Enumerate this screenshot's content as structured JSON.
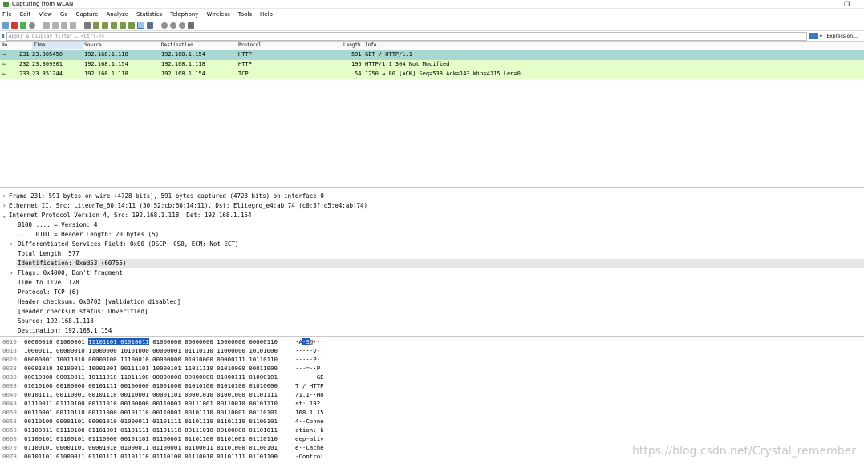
{
  "window": {
    "title": "Capturing from WLAN",
    "restore": "❐"
  },
  "menu": [
    "File",
    "Edit",
    "View",
    "Go",
    "Capture",
    "Analyze",
    "Statistics",
    "Telephony",
    "Wireless",
    "Tools",
    "Help"
  ],
  "toolbar_icons": [
    "shark-fin-icon",
    "stop-icon",
    "restart-icon",
    "options-gear-icon",
    "open-file-icon",
    "save-file-icon",
    "close-file-icon",
    "reload-icon",
    "find-icon",
    "back-icon",
    "forward-icon",
    "go-to-packet-icon",
    "first-packet-icon",
    "last-packet-icon",
    "autoscroll-icon",
    "colorize-icon",
    "zoom-in-icon",
    "zoom-out-icon",
    "normal-size-icon",
    "resize-columns-icon"
  ],
  "filter": {
    "placeholder": "Apply a display filter … <Ctrl-/>",
    "expression": "Expression…",
    "bookmark": "▮",
    "dropdown": "▾"
  },
  "columns": [
    "No.",
    "Time",
    "Source",
    "Destination",
    "Protocol",
    "Length",
    "Info"
  ],
  "packets": [
    {
      "arrow": "→",
      "no": "231",
      "time": "23.305450",
      "src": "192.168.1.118",
      "dst": "192.168.1.154",
      "proto": "HTTP",
      "len": "591",
      "info": "GET / HTTP/1.1",
      "selected": true
    },
    {
      "arrow": "←",
      "no": "232",
      "time": "23.309301",
      "src": "192.168.1.154",
      "dst": "192.168.1.118",
      "proto": "HTTP",
      "len": "196",
      "info": "HTTP/1.1 304 Not Modified",
      "selected": false
    },
    {
      "arrow": "←",
      "no": "233",
      "time": "23.351244",
      "src": "192.168.1.118",
      "dst": "192.168.1.154",
      "proto": "TCP",
      "len": "54",
      "info": "1250 → 80 [ACK] Seq=538 Ack=143 Win=4115 Len=0",
      "selected": false
    }
  ],
  "details": [
    {
      "twisty": "›",
      "indent": 0,
      "text": "Frame 231: 591 bytes on wire (4728 bits), 591 bytes captured (4728 bits) on interface 0",
      "hl": false
    },
    {
      "twisty": "›",
      "indent": 0,
      "text": "Ethernet II, Src: LiteonTe_60:14:11 (30:52:cb:60:14:11), Dst: Elitegro_e4:ab:74 (c0:3f:d5:e4:ab:74)",
      "hl": false
    },
    {
      "twisty": "⌄",
      "indent": 0,
      "text": "Internet Protocol Version 4, Src: 192.168.1.118, Dst: 192.168.1.154",
      "hl": false
    },
    {
      "twisty": "",
      "indent": 1,
      "text": "0100 .... = Version: 4",
      "hl": false
    },
    {
      "twisty": "",
      "indent": 1,
      "text": ".... 0101 = Header Length: 20 bytes (5)",
      "hl": false
    },
    {
      "twisty": "›",
      "indent": 1,
      "text": "Differentiated Services Field: 0x00 (DSCP: CS0, ECN: Not-ECT)",
      "hl": false
    },
    {
      "twisty": "",
      "indent": 1,
      "text": "Total Length: 577",
      "hl": false
    },
    {
      "twisty": "",
      "indent": 1,
      "text": "Identification: 0xed53 (60755)",
      "hl": true
    },
    {
      "twisty": "›",
      "indent": 1,
      "text": "Flags: 0x4000, Don't fragment",
      "hl": false
    },
    {
      "twisty": "",
      "indent": 1,
      "text": "Time to live: 128",
      "hl": false
    },
    {
      "twisty": "",
      "indent": 1,
      "text": "Protocol: TCP (6)",
      "hl": false
    },
    {
      "twisty": "",
      "indent": 1,
      "text": "Header checksum: 0x8702 [validation disabled]",
      "hl": false
    },
    {
      "twisty": "",
      "indent": 1,
      "text": "[Header checksum status: Unverified]",
      "hl": false
    },
    {
      "twisty": "",
      "indent": 1,
      "text": "Source: 192.168.1.118",
      "hl": false
    },
    {
      "twisty": "",
      "indent": 1,
      "text": "Destination: 192.168.1.154",
      "hl": false
    }
  ],
  "bytes": [
    {
      "off": "0010",
      "pre": "00000010 01000001 ",
      "sel": "11101101 01010011",
      "post": " 01000000 00000000 10000000 00000110",
      "asc_pre": "·A",
      "asc_sel": "·S",
      "asc_post": "@···"
    },
    {
      "off": "0018",
      "pre": "10000111 00000010 11000000 10101000 00000001 01110110 11000000 10101000",
      "sel": "",
      "post": "",
      "asc_pre": "·····v··",
      "asc_sel": "",
      "asc_post": ""
    },
    {
      "off": "0020",
      "pre": "00000001 10011010 00000100 11100010 00000000 01010000 00000111 10110110",
      "sel": "",
      "post": "",
      "asc_pre": "·····P··",
      "asc_sel": "",
      "asc_post": ""
    },
    {
      "off": "0028",
      "pre": "00001010 10100011 10001001 00111101 10000101 11011110 01010000 00011000",
      "sel": "",
      "post": "",
      "asc_pre": "···=··P·",
      "asc_sel": "",
      "asc_post": ""
    },
    {
      "off": "0030",
      "pre": "00010000 00010011 10111010 11011100 00000000 00000000 01000111 01000101",
      "sel": "",
      "post": "",
      "asc_pre": "······GE",
      "asc_sel": "",
      "asc_post": ""
    },
    {
      "off": "0038",
      "pre": "01010100 00100000 00101111 00100000 01001000 01010100 01010100 01010000",
      "sel": "",
      "post": "",
      "asc_pre": "T / HTTP",
      "asc_sel": "",
      "asc_post": ""
    },
    {
      "off": "0040",
      "pre": "00101111 00110001 00101110 00110001 00001101 00001010 01001000 01101111",
      "sel": "",
      "post": "",
      "asc_pre": "/1.1··Ho",
      "asc_sel": "",
      "asc_post": ""
    },
    {
      "off": "0048",
      "pre": "01110011 01110100 00111010 00100000 00110001 00111001 00110010 00101110",
      "sel": "",
      "post": "",
      "asc_pre": "st: 192.",
      "asc_sel": "",
      "asc_post": ""
    },
    {
      "off": "0050",
      "pre": "00110001 00110110 00111000 00101110 00110001 00101110 00110001 00110101",
      "sel": "",
      "post": "",
      "asc_pre": "168.1.15",
      "asc_sel": "",
      "asc_post": ""
    },
    {
      "off": "0058",
      "pre": "00110100 00001101 00001010 01000011 01101111 01101110 01101110 01100101",
      "sel": "",
      "post": "",
      "asc_pre": "4··Conne",
      "asc_sel": "",
      "asc_post": ""
    },
    {
      "off": "0060",
      "pre": "01100011 01110100 01101001 01101111 01101110 00111010 00100000 01101011",
      "sel": "",
      "post": "",
      "asc_pre": "ction: k",
      "asc_sel": "",
      "asc_post": ""
    },
    {
      "off": "0068",
      "pre": "01100101 01100101 01110000 00101101 01100001 01101100 01101001 01110110",
      "sel": "",
      "post": "",
      "asc_pre": "eep-aliv",
      "asc_sel": "",
      "asc_post": ""
    },
    {
      "off": "0070",
      "pre": "01100101 00001101 00001010 01000011 01100001 01100011 01101000 01100101",
      "sel": "",
      "post": "",
      "asc_pre": "e··Cache",
      "asc_sel": "",
      "asc_post": ""
    },
    {
      "off": "0078",
      "pre": "00101101 01000011 01101111 01101110 01110100 01110010 01101111 01101100",
      "sel": "",
      "post": "",
      "asc_pre": "-Control",
      "asc_sel": "",
      "asc_post": ""
    }
  ],
  "watermark": "https://blog.csdn.net/Crystal_remember",
  "colors": {
    "http_row": "#e4ffc7",
    "selected_row": "#a9d8d2",
    "tcp_row": "#e4ffc7",
    "detail_hl": "#e6e6e6",
    "byte_sel": "#1c5bc0"
  }
}
